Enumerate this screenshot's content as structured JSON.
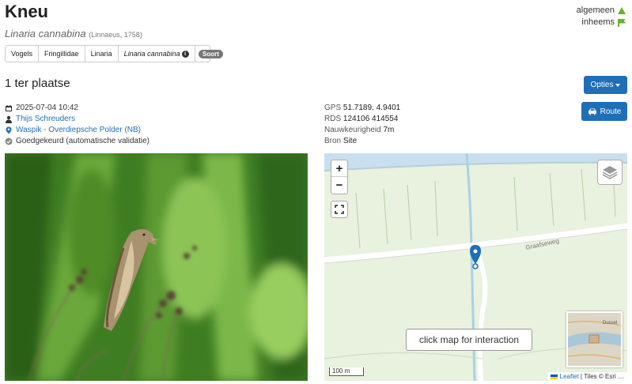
{
  "species": {
    "name": "Kneu",
    "scientific": "Linaria cannabina",
    "author": "(Linnaeus, 1758)"
  },
  "badges": [
    {
      "label": "algemeen",
      "icon": "triangle-icon",
      "color": "#6ab22f"
    },
    {
      "label": "inheems",
      "icon": "flag-icon",
      "color": "#6ab22f"
    }
  ],
  "breadcrumbs": [
    "Vogels",
    "Fringillidae",
    "Linaria",
    "Linaria cannabina"
  ],
  "rank_badge": "Soort",
  "observation": {
    "title": "1 ter plaatse",
    "options_label": "Opties",
    "route_label": "Route",
    "datetime": "2025-07-04 10:42",
    "observer": "Thijs Schreuders",
    "location": "Waspik - Overdiepsche Polder (NB)",
    "status": "Goedgekeurd (automatische validatie)"
  },
  "meta": {
    "gps_label": "GPS",
    "gps_value": "51.7189, 4.9401",
    "rds_label": "RDS",
    "rds_value": "124106 414554",
    "acc_label": "Nauwkeurigheid",
    "acc_value": "7m",
    "src_label": "Bron",
    "src_value": "Site"
  },
  "map": {
    "zoom_in": "+",
    "zoom_out": "−",
    "road_label": "Graafseweg",
    "click_message": "click map for interaction",
    "scale_label": "100 m",
    "attribution_link": "Leaflet",
    "attribution_text": " | Tiles © Esri …",
    "minimap_label": "Dussel"
  },
  "colors": {
    "accent": "#1f6fb8",
    "badge_green": "#6ab22f"
  }
}
